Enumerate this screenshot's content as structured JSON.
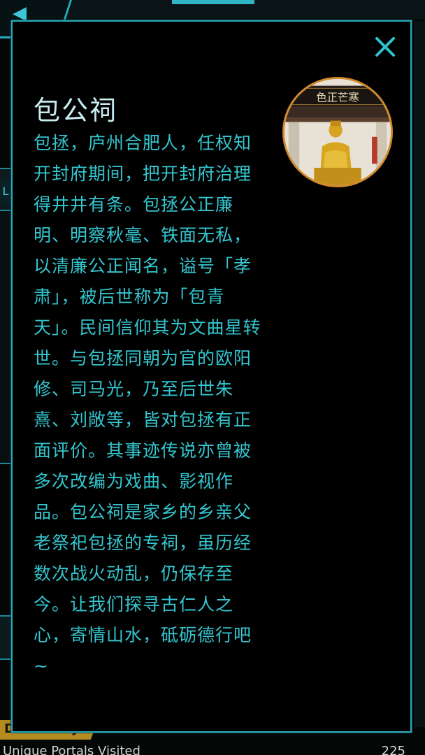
{
  "background": {
    "bottom_tab_label": "Discovery",
    "bottom_row_left": "Unique Portals Visited",
    "bottom_row_right": "225",
    "left_label": "L"
  },
  "dialog": {
    "close_icon": "close-icon",
    "title": "包公祠",
    "description": "包拯，庐州合肥人，任权知开封府期间，把开封府治理得井井有条。包拯公正廉明、明察秋毫、铁面无私，以清廉公正闻名，谥号「孝肃」，被后世称为「包青天」。民间信仰其为文曲星转世。与包拯同朝为官的欧阳修、司马光，乃至后世朱熹、刘敞等，皆对包拯有正面评价。其事迹传说亦曾被多次改编为戏曲、影视作品。包公祠是家乡的乡亲父老祭祀包拯的专祠，虽历经数次战火动乱，仍保存至今。让我们探寻古仁人之心，寄情山水，砥砺德行吧~",
    "image_sign_text": "色正芒寒"
  },
  "colors": {
    "accent": "#2aa8b6",
    "text": "#34c6cf",
    "title": "#c7ecef",
    "image_border": "#d08a2c"
  }
}
